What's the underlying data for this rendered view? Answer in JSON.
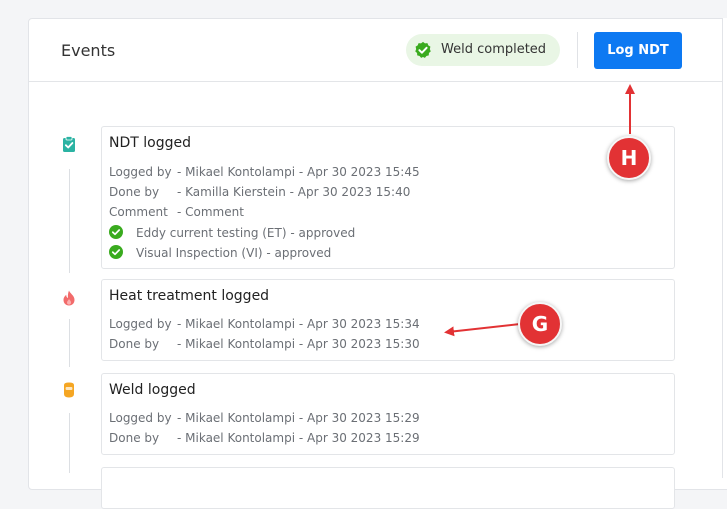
{
  "events_title": "Events",
  "status_badge": {
    "label": "Weld completed",
    "icon": "check-circle-icon"
  },
  "log_ndt_button": "Log NDT",
  "colors": {
    "accent": "#0d79f2",
    "success": "#3aab1f",
    "annotation": "#e23234"
  },
  "events": [
    {
      "icon": "clipboard-check-icon",
      "title": "NDT logged",
      "logged_by": {
        "label": "Logged by",
        "value": "- Mikael Kontolampi - Apr 30 2023 15:45"
      },
      "done_by": {
        "label": "Done by",
        "value": "- Kamilla Kierstein - Apr 30 2023 15:40"
      },
      "comment": {
        "label": "Comment",
        "value": "- Comment"
      },
      "results": [
        "Eddy current testing (ET) - approved",
        "Visual Inspection (VI) - approved"
      ]
    },
    {
      "icon": "flame-icon",
      "title": "Heat treatment logged",
      "logged_by": {
        "label": "Logged by",
        "value": "- Mikael Kontolampi - Apr 30 2023 15:34"
      },
      "done_by": {
        "label": "Done by",
        "value": "- Mikael Kontolampi - Apr 30 2023 15:30"
      }
    },
    {
      "icon": "welding-mask-icon",
      "title": "Weld logged",
      "logged_by": {
        "label": "Logged by",
        "value": "- Mikael Kontolampi - Apr 30 2023 15:29"
      },
      "done_by": {
        "label": "Done by",
        "value": "- Mikael Kontolampi - Apr 30 2023 15:29"
      }
    }
  ],
  "annotations": {
    "h": "H",
    "g": "G"
  }
}
